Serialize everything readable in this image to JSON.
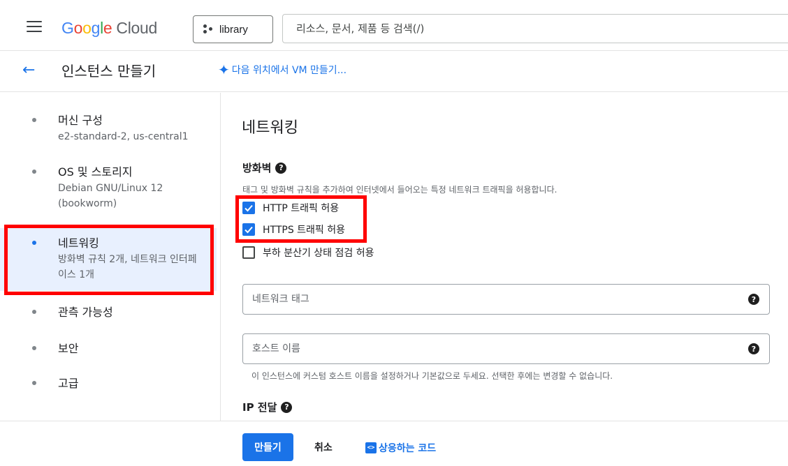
{
  "topbar": {
    "logo_letters": [
      "G",
      "o",
      "o",
      "g",
      "l",
      "e"
    ],
    "logo_cloud": "Cloud",
    "project_label": "library",
    "search_placeholder": "리소스, 문서, 제품 등 검색(/)"
  },
  "subbar": {
    "title": "인스턴스 만들기",
    "vm_link": "다음 위치에서 VM 만들기..."
  },
  "steps": [
    {
      "label": "머신 구성",
      "sub": "e2-standard-2, us-central1"
    },
    {
      "label": "OS 및 스토리지",
      "sub": "Debian GNU/Linux 12 (bookworm)"
    },
    {
      "label": "네트워킹",
      "sub": "방화벽 규칙 2개, 네트워크 인터페이스 1개",
      "active": true
    },
    {
      "label": "관측 가능성"
    },
    {
      "label": "보안"
    },
    {
      "label": "고급"
    }
  ],
  "main": {
    "section_title": "네트워킹",
    "firewall_title": "방화벽",
    "firewall_desc": "태그 및 방화벽 규칙을 추가하여 인터넷에서 들어오는 특정 네트워크 트래픽을 허용합니다.",
    "checkboxes": [
      {
        "label": "HTTP 트래픽 허용",
        "checked": true
      },
      {
        "label": "HTTPS 트래픽 허용",
        "checked": true
      },
      {
        "label": "부하 분산기 상태 점검 허용",
        "checked": false
      }
    ],
    "network_tags_placeholder": "네트워크 태그",
    "hostname_placeholder": "호스트 이름",
    "hostname_hint": "이 인스턴스에 커스텀 호스트 이름을 설정하거나 기본값으로 두세요. 선택한 후에는 변경할 수 없습니다.",
    "ip_forward_title": "IP 전달",
    "help_glyph": "?"
  },
  "actions": {
    "create": "만들기",
    "cancel": "취소",
    "code_icon": "<>",
    "code_link": "상응하는 코드"
  },
  "colors": {
    "accent": "#1a73e8",
    "highlight": "#ff0000",
    "active_bg": "#e8f0fe"
  }
}
